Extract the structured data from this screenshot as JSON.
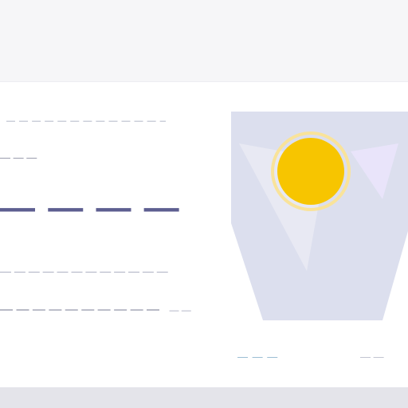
{
  "weather": {
    "breadcrumb": "— — — — — — — — — — — — — —",
    "tag": "— — —",
    "big_temp": "— — — —",
    "feels_line": "— — — — — — — — — — — —",
    "details": "— — — — — — — — — —",
    "details_units": "— —"
  },
  "footer": {
    "link": "— — —",
    "extra": "— —"
  },
  "colors": {
    "sun": "#f7c500",
    "sky": "#dcdfee",
    "accent": "#5d5e90"
  },
  "icons": {
    "weather": "sun-icon"
  }
}
